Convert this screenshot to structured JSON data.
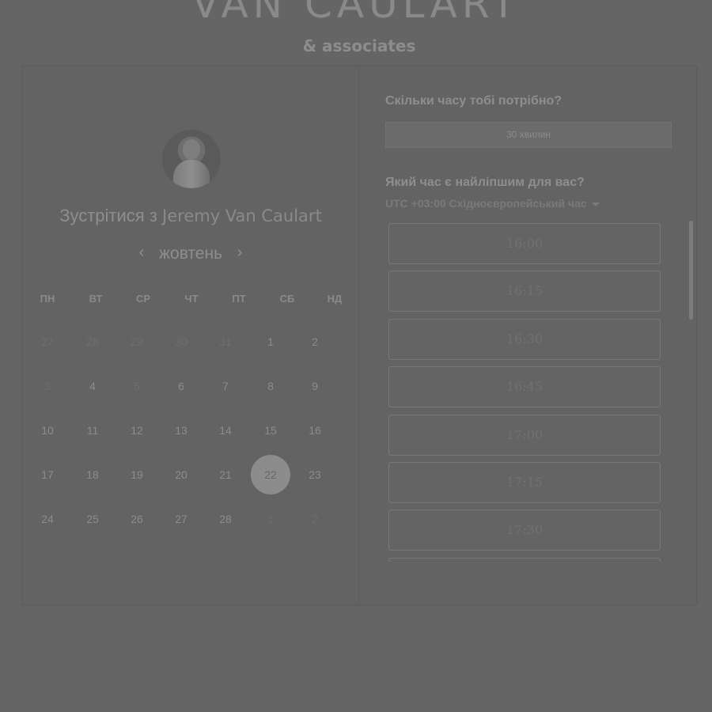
{
  "brand": {
    "title": "VAN CAULART",
    "subtitle": "& associates"
  },
  "meeting": {
    "prefix": "Зустрітися з",
    "host_name": "Jeremy Van Caulart"
  },
  "calendar": {
    "month": "жовтень",
    "weekdays": [
      "ПН",
      "ВТ",
      "СР",
      "ЧТ",
      "ПТ",
      "СБ",
      "НД"
    ],
    "weeks": [
      [
        {
          "d": "27",
          "muted": true
        },
        {
          "d": "28",
          "muted": true
        },
        {
          "d": "29",
          "muted": true
        },
        {
          "d": "30",
          "muted": true
        },
        {
          "d": "31",
          "muted": true
        },
        {
          "d": "1"
        },
        {
          "d": "2"
        }
      ],
      [
        {
          "d": "3",
          "muted": true
        },
        {
          "d": "4"
        },
        {
          "d": "5",
          "muted": true
        },
        {
          "d": "6"
        },
        {
          "d": "7"
        },
        {
          "d": "8"
        },
        {
          "d": "9"
        }
      ],
      [
        {
          "d": "10"
        },
        {
          "d": "11"
        },
        {
          "d": "12"
        },
        {
          "d": "13"
        },
        {
          "d": "14"
        },
        {
          "d": "15"
        },
        {
          "d": "16"
        }
      ],
      [
        {
          "d": "17"
        },
        {
          "d": "18"
        },
        {
          "d": "19"
        },
        {
          "d": "20"
        },
        {
          "d": "21"
        },
        {
          "d": "22",
          "selected": true
        },
        {
          "d": "23"
        }
      ],
      [
        {
          "d": "24"
        },
        {
          "d": "25"
        },
        {
          "d": "26"
        },
        {
          "d": "27"
        },
        {
          "d": "28"
        },
        {
          "d": "1",
          "muted": true
        },
        {
          "d": "2",
          "muted": true
        }
      ]
    ]
  },
  "booking": {
    "duration_question": "Скільки часу тобі потрібно?",
    "duration_value": "30 хвилин",
    "time_question": "Який час є найліпшим для вас?",
    "timezone": "UTC +03:00 Східноєвропейський час",
    "slots": [
      "16:00",
      "16:15",
      "16:30",
      "16:45",
      "17:00",
      "17:15",
      "17:30",
      ""
    ]
  }
}
